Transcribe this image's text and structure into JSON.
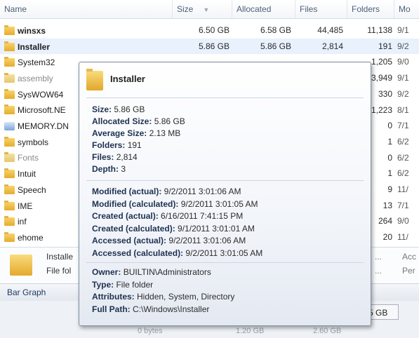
{
  "columns": {
    "name": "Name",
    "size": "Size",
    "allocated": "Allocated",
    "files": "Files",
    "folders": "Folders",
    "modified": "Mo"
  },
  "rows": [
    {
      "name": "winsxs",
      "size": "6.50 GB",
      "allocated": "6.58 GB",
      "files": "44,485",
      "folders": "11,138",
      "mod": "9/1"
    },
    {
      "name": "Installer",
      "size": "5.86 GB",
      "allocated": "5.86 GB",
      "files": "2,814",
      "folders": "191",
      "mod": "9/2"
    },
    {
      "name": "System32",
      "size": "",
      "allocated": "",
      "files": "",
      "folders": "1,205",
      "mod": "9/0"
    },
    {
      "name": "assembly",
      "size": "",
      "allocated": "",
      "files": "",
      "folders": "3,949",
      "mod": "9/1"
    },
    {
      "name": "SysWOW64",
      "size": "",
      "allocated": "",
      "files": "",
      "folders": "330",
      "mod": "9/2"
    },
    {
      "name": "Microsoft.NE",
      "size": "",
      "allocated": "",
      "files": "",
      "folders": "1,223",
      "mod": "8/1"
    },
    {
      "name": "MEMORY.DN",
      "size": "",
      "allocated": "",
      "files": "",
      "folders": "0",
      "mod": "7/1"
    },
    {
      "name": "symbols",
      "size": "",
      "allocated": "",
      "files": "",
      "folders": "1",
      "mod": "6/2"
    },
    {
      "name": "Fonts",
      "size": "",
      "allocated": "",
      "files": "",
      "folders": "0",
      "mod": "6/2"
    },
    {
      "name": "Intuit",
      "size": "",
      "allocated": "",
      "files": "",
      "folders": "1",
      "mod": "6/2"
    },
    {
      "name": "Speech",
      "size": "",
      "allocated": "",
      "files": "",
      "folders": "9",
      "mod": "11/"
    },
    {
      "name": "IME",
      "size": "",
      "allocated": "",
      "files": "",
      "folders": "13",
      "mod": "7/1"
    },
    {
      "name": "inf",
      "size": "",
      "allocated": "",
      "files": "",
      "folders": "264",
      "mod": "9/0"
    },
    {
      "name": "ehome",
      "size": "",
      "allocated": "",
      "files": "",
      "folders": "20",
      "mod": "11/"
    }
  ],
  "preview": {
    "name": "Installe",
    "type": "File fol",
    "right1": "...",
    "right2": "...",
    "far1": "Acc",
    "far2": "Per"
  },
  "bargraph": {
    "label": "Bar Graph",
    "value": "5 GB",
    "ticks": [
      "0 bytes",
      "1.20 GB",
      "2.60 GB"
    ]
  },
  "tooltip": {
    "title": "Installer",
    "group1": [
      {
        "k": "Size:",
        "v": "5.86 GB"
      },
      {
        "k": "Allocated Size:",
        "v": "5.86 GB"
      },
      {
        "k": "Average Size:",
        "v": "2.13 MB"
      },
      {
        "k": "Folders:",
        "v": "191"
      },
      {
        "k": "Files:",
        "v": "2,814"
      },
      {
        "k": "Depth:",
        "v": "3"
      }
    ],
    "group2": [
      {
        "k": "Modified (actual):",
        "v": "9/2/2011 3:01:06 AM"
      },
      {
        "k": "Modified (calculated):",
        "v": "9/2/2011 3:01:05 AM"
      },
      {
        "k": "Created (actual):",
        "v": "6/16/2011 7:41:15 PM"
      },
      {
        "k": "Created (calculated):",
        "v": "9/1/2011 3:01:01 AM"
      },
      {
        "k": "Accessed (actual):",
        "v": "9/2/2011 3:01:06 AM"
      },
      {
        "k": "Accessed (calculated):",
        "v": "9/2/2011 3:01:05 AM"
      }
    ],
    "group3": [
      {
        "k": "Owner:",
        "v": "BUILTIN\\Administrators"
      },
      {
        "k": "Type:",
        "v": "File folder"
      },
      {
        "k": "Attributes:",
        "v": "Hidden, System, Directory"
      },
      {
        "k": "Full Path:",
        "v": "C:\\Windows\\Installer"
      }
    ]
  }
}
